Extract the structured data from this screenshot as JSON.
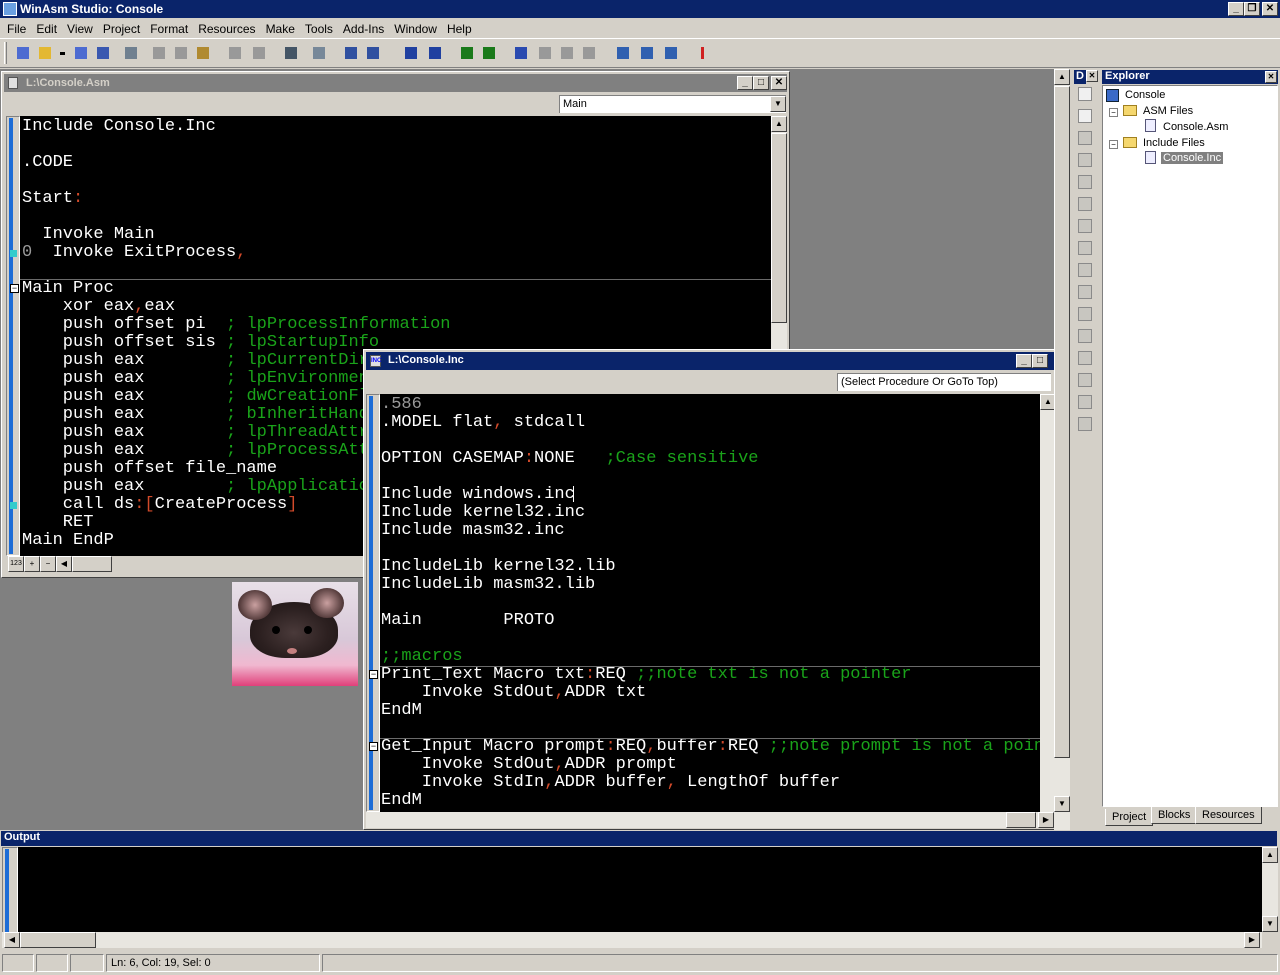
{
  "app": {
    "title": "WinAsm Studio: Console",
    "menu": [
      "File",
      "Edit",
      "View",
      "Project",
      "Format",
      "Resources",
      "Make",
      "Tools",
      "Add-Ins",
      "Window",
      "Help"
    ]
  },
  "editor_main": {
    "title": "L:\\Console.Asm",
    "proc_combo": "Main",
    "lines": [
      {
        "t": "Include Console.Inc"
      },
      {
        "t": ""
      },
      {
        "t": ".CODE"
      },
      {
        "t": ""
      },
      {
        "t": "Start",
        "p": ":"
      },
      {
        "t": ""
      },
      {
        "t": "  Invoke Main"
      },
      {
        "t": "  Invoke ExitProcess",
        "p": ",",
        "n": "0"
      },
      {
        "t": ""
      },
      {
        "t": "Main Proc"
      },
      {
        "t": "    xor eax",
        "p": ",",
        "t2": "eax"
      },
      {
        "t": "    push offset pi  ",
        "c": "; lpProcessInformation"
      },
      {
        "t": "    push offset sis ",
        "c": "; lpStartupInfo"
      },
      {
        "t": "    push eax        ",
        "c": "; lpCurrentDirectory"
      },
      {
        "t": "    push eax        ",
        "c": "; lpEnvironment"
      },
      {
        "t": "    push eax        ",
        "c": "; dwCreationFlags"
      },
      {
        "t": "    push eax        ",
        "c": "; bInheritHandles"
      },
      {
        "t": "    push eax        ",
        "c": "; lpThreadAttributes"
      },
      {
        "t": "    push eax        ",
        "c": "; lpProcessAttributes"
      },
      {
        "t": "    push offset file_name"
      },
      {
        "t": "    push eax        ",
        "c": "; lpApplicationName"
      },
      {
        "t": "    call ds",
        "p": ":[",
        "t2": "CreateProcess",
        "p2": "]"
      },
      {
        "t": "    RET"
      },
      {
        "t": "Main EndP"
      }
    ]
  },
  "editor_inc": {
    "title": "L:\\Console.Inc",
    "proc_combo": "(Select Procedure Or GoTo Top)",
    "lines": [
      {
        "n": ".586"
      },
      {
        "t": ".MODEL flat",
        "p": ",",
        "t2": " stdcall"
      },
      {
        "t": ""
      },
      {
        "t": "OPTION CASEMAP",
        "p": ":",
        "t2": "NONE   ",
        "c": ";Case sensitive"
      },
      {
        "t": ""
      },
      {
        "t": "Include windows.inc"
      },
      {
        "t": "Include kernel32.inc"
      },
      {
        "t": "Include masm32.inc"
      },
      {
        "t": ""
      },
      {
        "t": "IncludeLib kernel32.lib"
      },
      {
        "t": "IncludeLib masm32.lib"
      },
      {
        "t": ""
      },
      {
        "t": "Main        PROTO"
      },
      {
        "t": ""
      },
      {
        "c": ";;macros"
      },
      {
        "t": "Print_Text Macro txt",
        "p": ":",
        "t2": "REQ ",
        "c": ";;note txt is not a pointer"
      },
      {
        "t": "    Invoke StdOut",
        "p": ",",
        "t2": "ADDR txt"
      },
      {
        "t": "EndM"
      },
      {
        "t": ""
      },
      {
        "t": "Get_Input Macro prompt",
        "p": ":",
        "t2": "REQ",
        "p2": ",",
        "t3": "buffer",
        "p3": ":",
        "t4": "REQ ",
        "c": ";;note prompt is not a pointer"
      },
      {
        "t": "    Invoke StdOut",
        "p": ",",
        "t2": "ADDR prompt"
      },
      {
        "t": "    Invoke StdIn",
        "p": ",",
        "t2": "ADDR buffer",
        "p2": ",",
        "t3": " LengthOf buffer"
      },
      {
        "t": "EndM"
      }
    ]
  },
  "explorer": {
    "title": "Explorer",
    "dock_label": "D",
    "root": "Console",
    "asm_folder": "ASM Files",
    "asm_file": "Console.Asm",
    "inc_folder": "Include Files",
    "inc_file": "Console.Inc",
    "tabs": [
      "Project",
      "Blocks",
      "Resources"
    ]
  },
  "output": {
    "title": "Output"
  },
  "status": {
    "position": "Ln: 6, Col: 19, Sel: 0"
  },
  "colors": {
    "title_active": "#0a246a",
    "comment": "#1aa31a",
    "punctuation": "#d24a2a",
    "gutter_bar": "#1c6cd6"
  },
  "icons": [
    "minimize-icon",
    "restore-icon",
    "close-icon",
    "new-project-icon",
    "open-icon",
    "save-icon",
    "cut-icon",
    "copy-icon",
    "paste-icon",
    "undo-icon",
    "redo-icon",
    "find-icon",
    "indent-icon",
    "outdent-icon",
    "comment-icon",
    "bookmark-icon",
    "build-icon",
    "run-icon",
    "help-icon"
  ]
}
